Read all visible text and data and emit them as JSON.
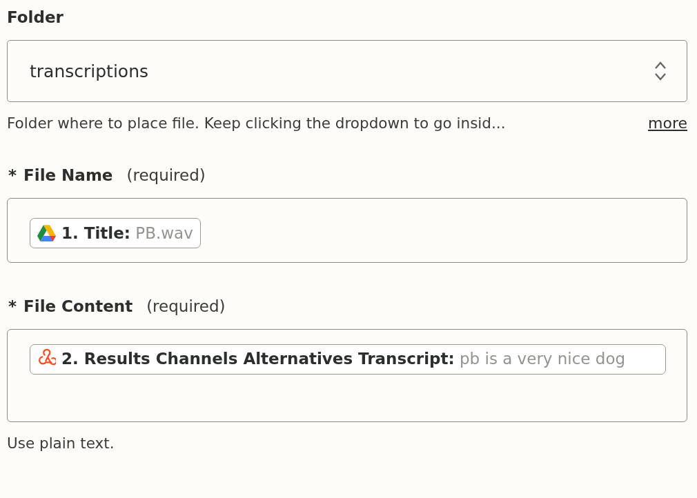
{
  "fields": [
    {
      "kind": "select",
      "label": "Folder",
      "value": "transcriptions",
      "help": "Folder where to place file. Keep clicking the dropdown to go insid...",
      "more": "more"
    },
    {
      "kind": "mapped",
      "asterisk": "*",
      "label": "File Name",
      "note": "(required)",
      "pills": [
        {
          "kind": "drive",
          "label": "1. Title:",
          "value": "PB.wav"
        }
      ]
    },
    {
      "kind": "textarea",
      "asterisk": "*",
      "label": "File Content",
      "note": "(required)",
      "pills": [
        {
          "kind": "webhook",
          "label": "2. Results Channels Alternatives Transcript:",
          "value": "pb is a very nice dog"
        }
      ],
      "help": "Use plain text."
    }
  ]
}
